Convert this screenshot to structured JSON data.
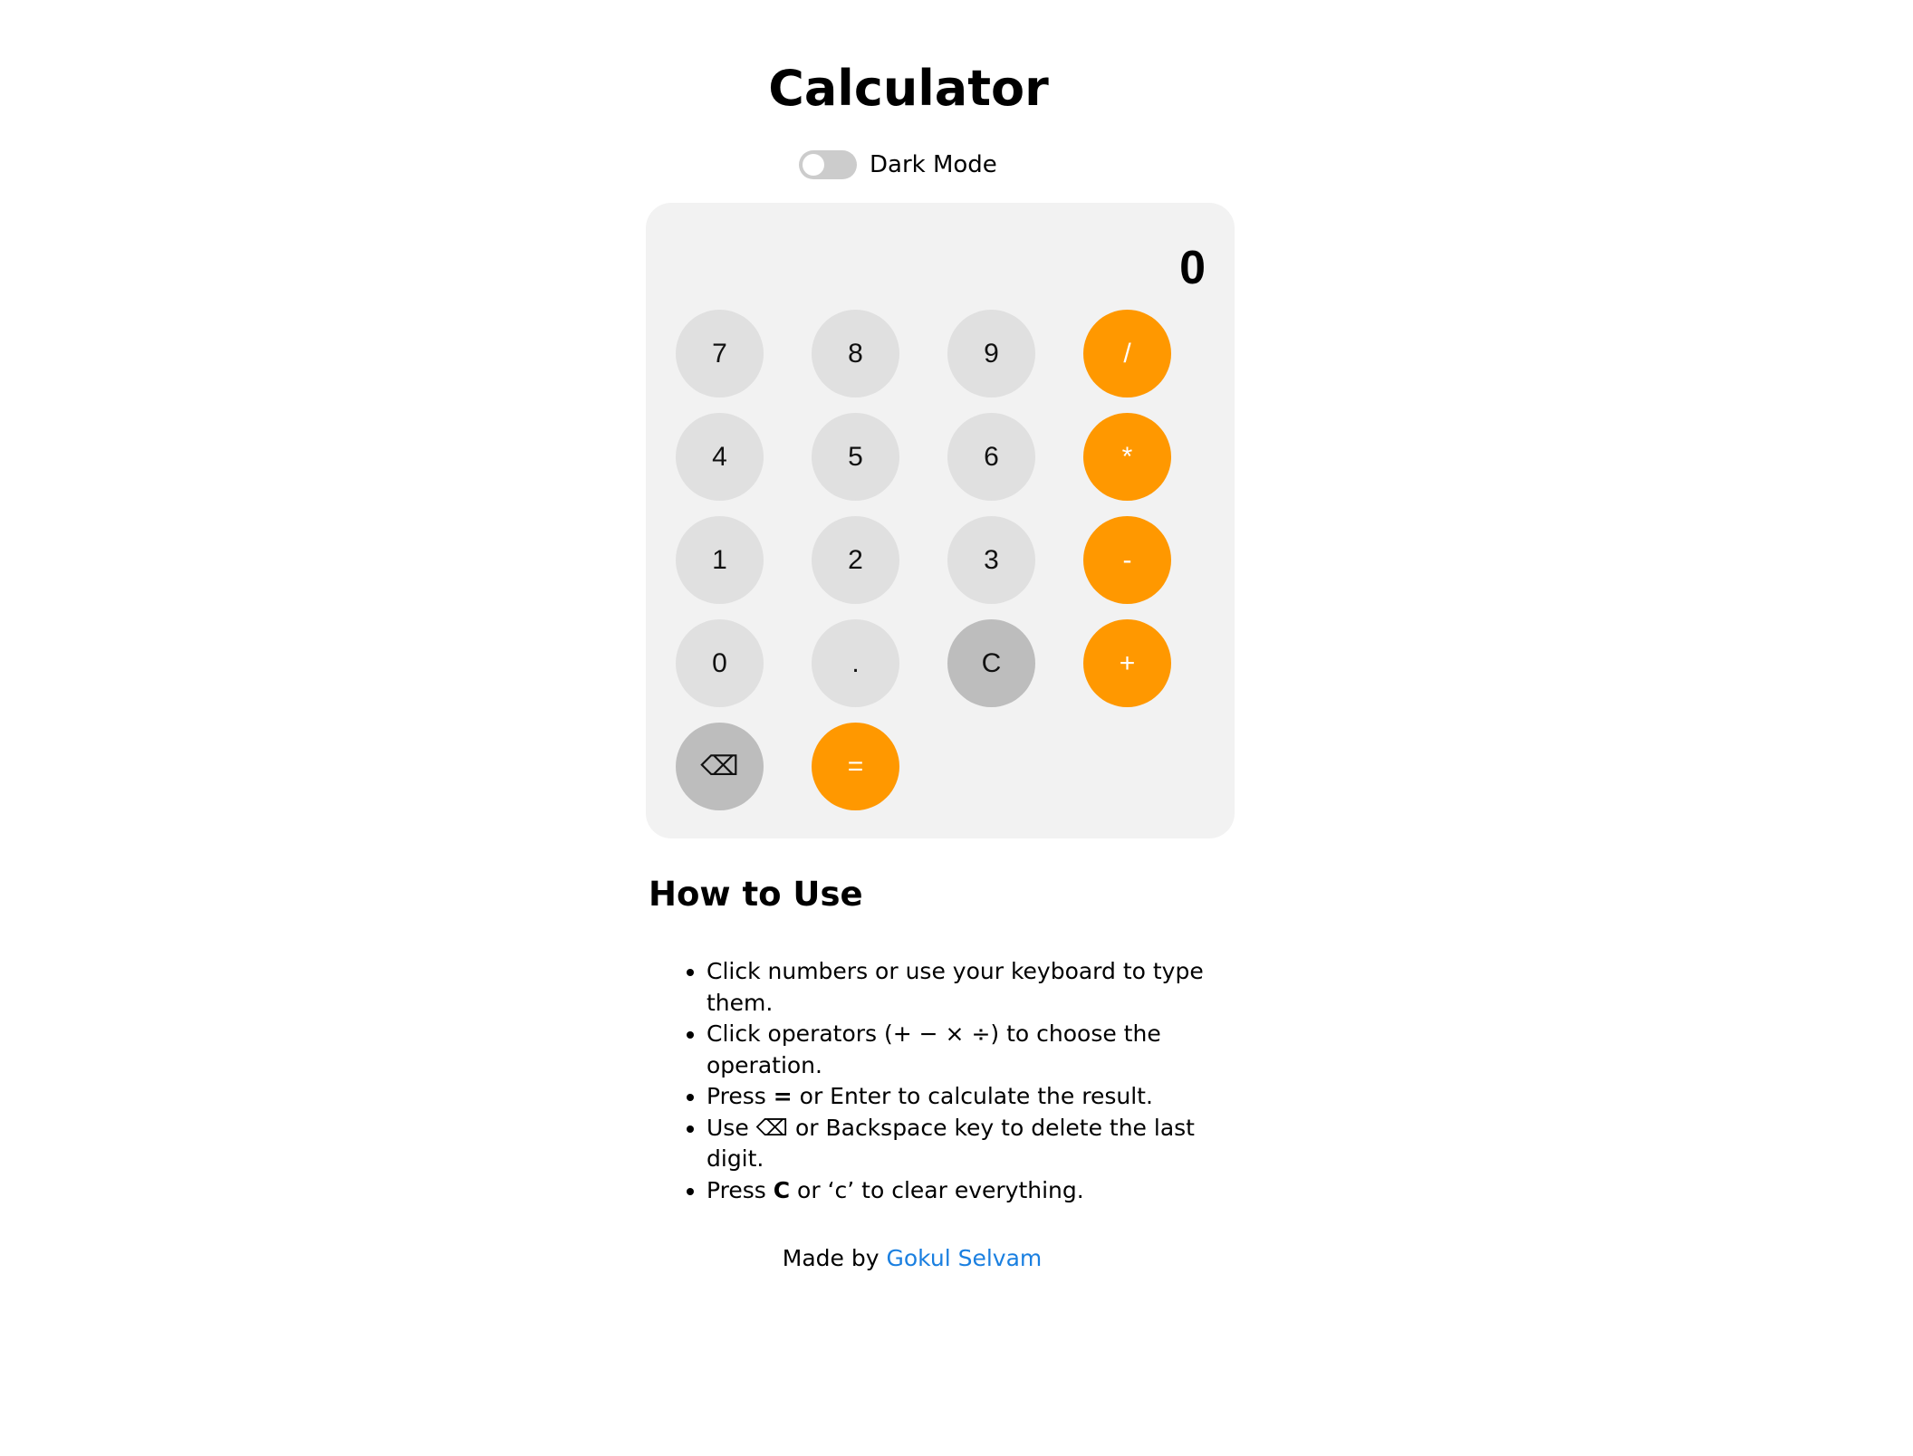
{
  "title": "Calculator",
  "dark_mode": {
    "label": "Dark Mode",
    "enabled": false
  },
  "display": {
    "value": "0"
  },
  "keys": {
    "k7": "7",
    "k8": "8",
    "k9": "9",
    "divide": "/",
    "k4": "4",
    "k5": "5",
    "k6": "6",
    "multiply": "*",
    "k1": "1",
    "k2": "2",
    "k3": "3",
    "subtract": "-",
    "k0": "0",
    "decimal": ".",
    "clear": "C",
    "add": "+",
    "backspace": "⌫",
    "equals": "="
  },
  "colors": {
    "operator": "#ff9800",
    "digit": "#e0e0e0",
    "function": "#bdbdbd",
    "panel": "#f2f2f2",
    "link": "#1a7fe0"
  },
  "howto": {
    "heading": "How to Use",
    "items": [
      {
        "text": "Click numbers or use your keyboard to type them."
      },
      {
        "text": "Click operators (+ − × ÷) to choose the operation."
      },
      {
        "pre": "Press ",
        "strong": "=",
        "post": " or Enter to calculate the result."
      },
      {
        "text": "Use ⌫ or Backspace key to delete the last digit."
      },
      {
        "pre": "Press ",
        "strong": "C",
        "post": " or ‘c’ to clear everything."
      }
    ]
  },
  "footer": {
    "prefix": "Made by",
    "author": "Gokul Selvam"
  }
}
